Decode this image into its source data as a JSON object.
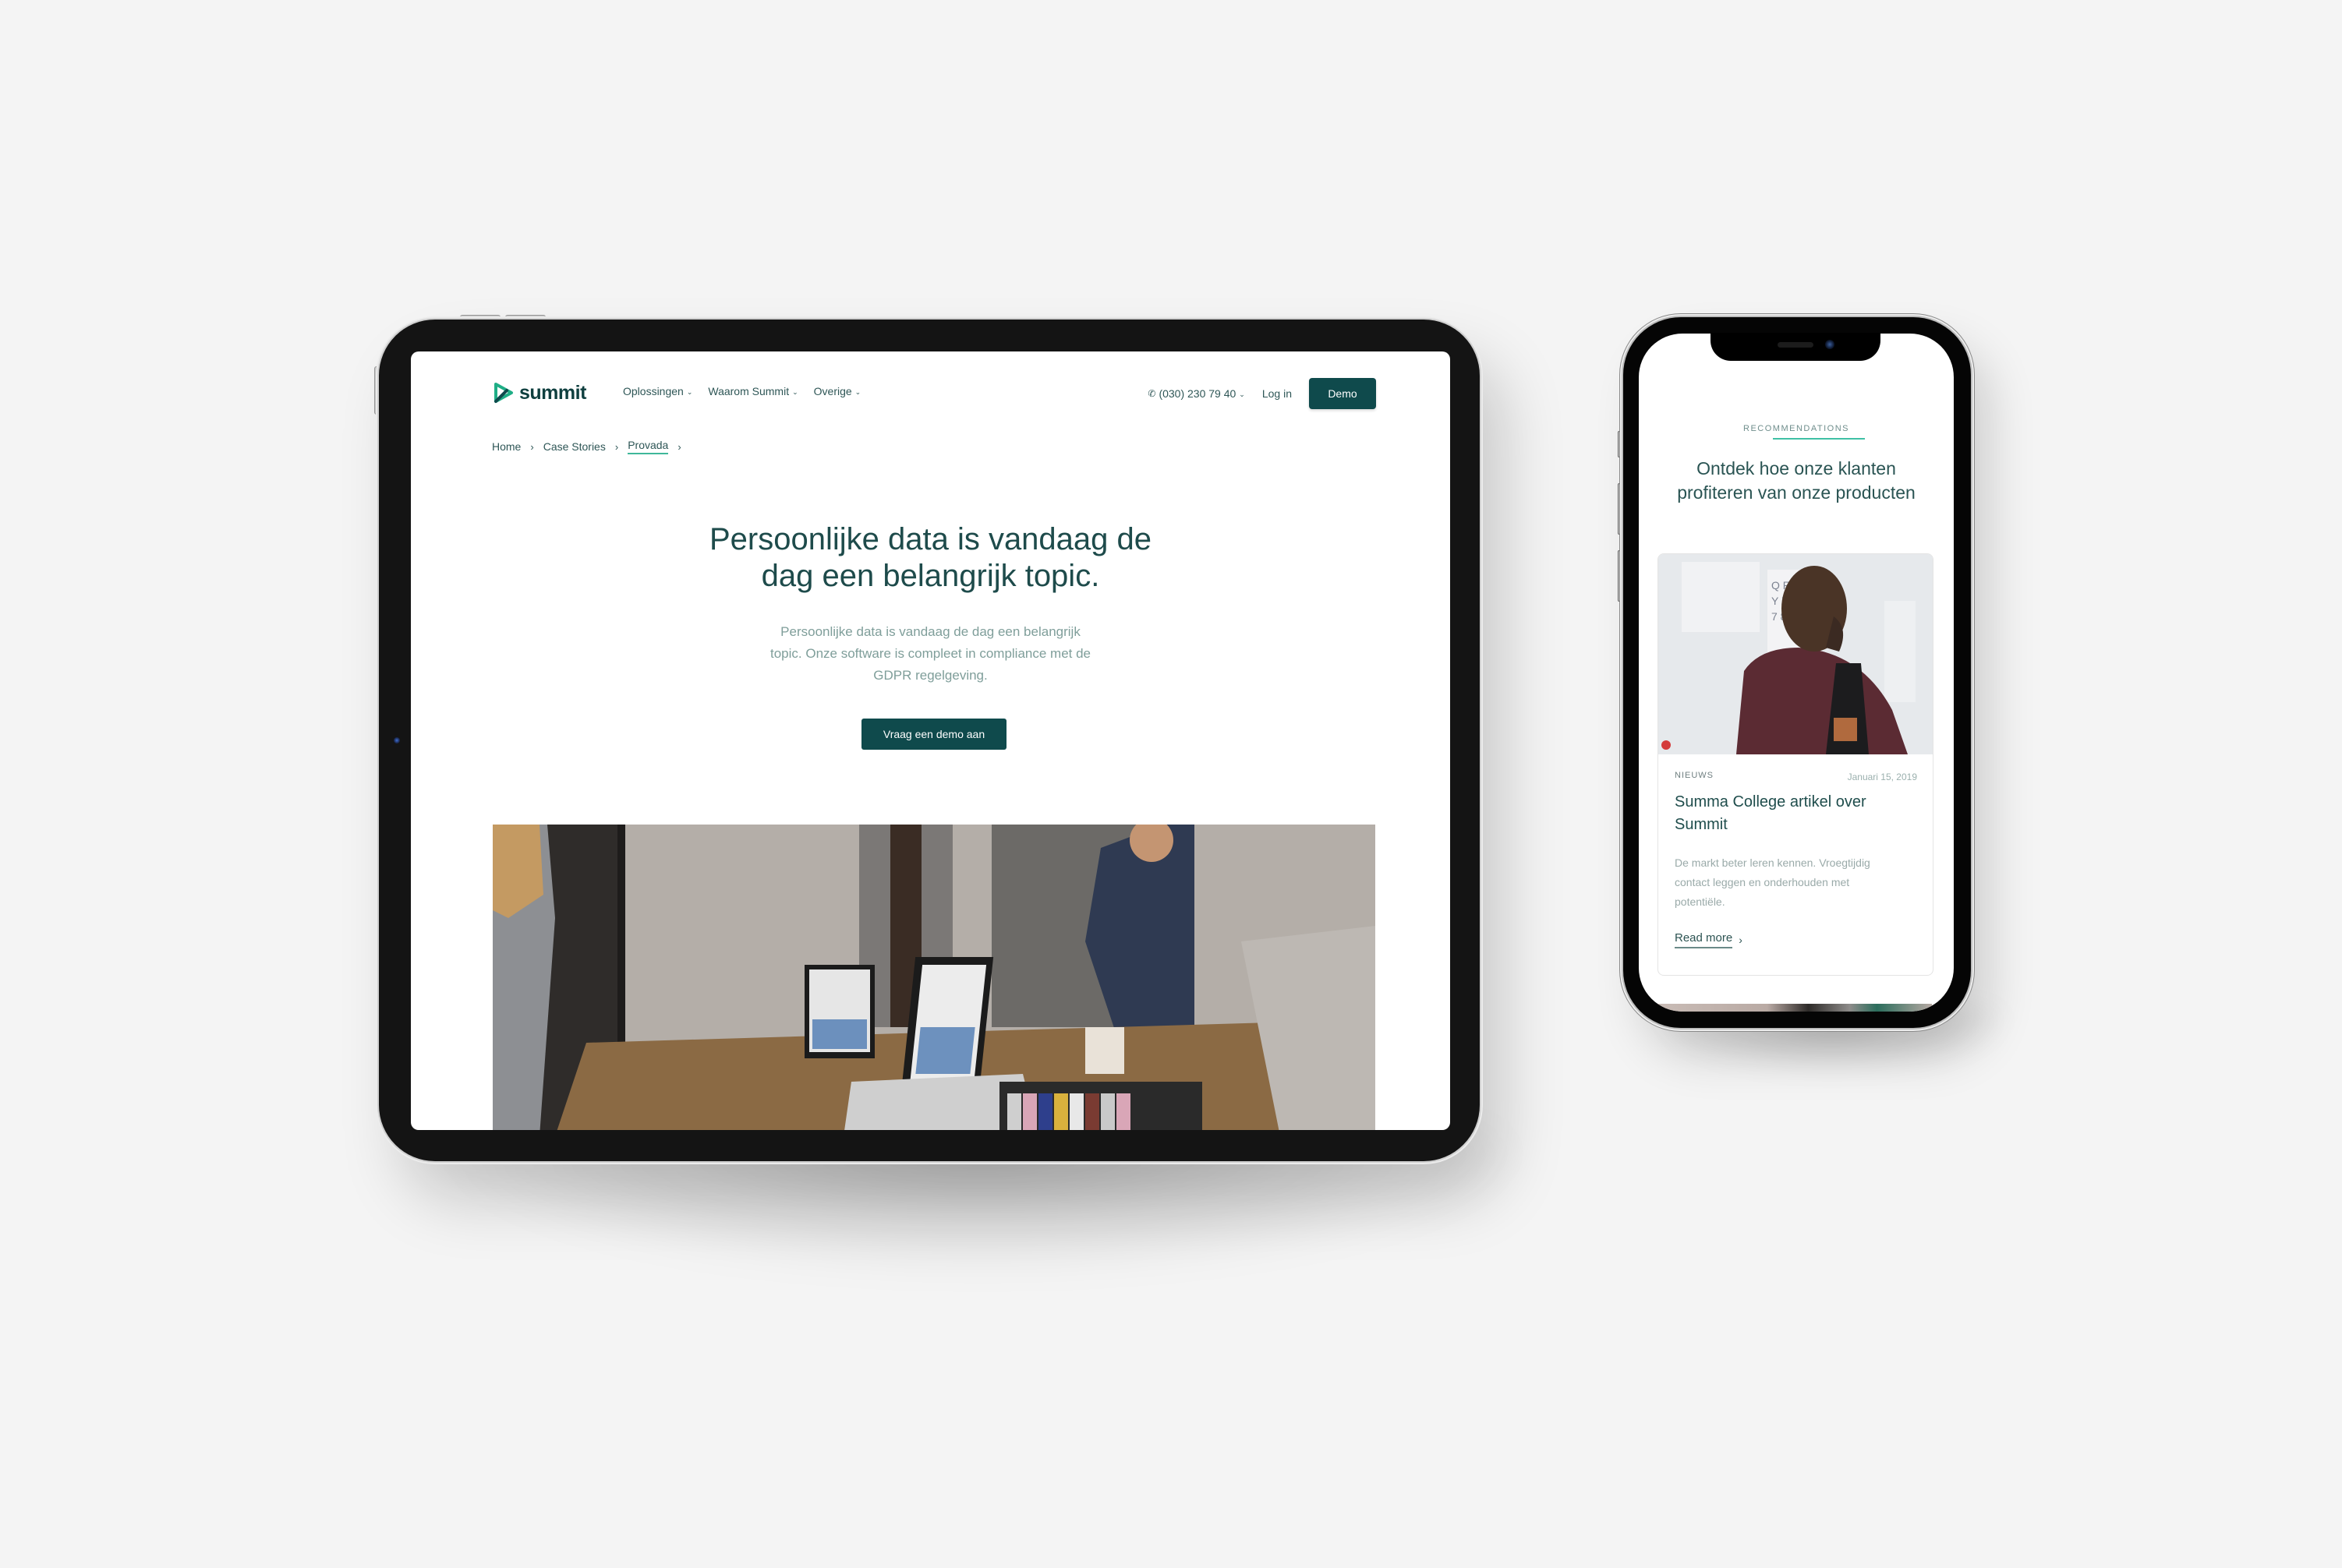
{
  "tablet": {
    "site": {
      "logo": {
        "text": "summit",
        "icon": "summit-logo-icon",
        "brand_color": "#1fae86",
        "text_color": "#0f3f3f"
      },
      "nav": {
        "items": [
          {
            "label": "Oplossingen",
            "icon": "chevron-down-icon",
            "chevron": "⌄"
          },
          {
            "label": "Waarom Summit",
            "icon": "chevron-down-icon",
            "chevron": "⌄"
          },
          {
            "label": "Overige",
            "icon": "chevron-down-icon",
            "chevron": "⌄"
          }
        ],
        "phone": {
          "icon": "phone-icon",
          "glyph": "✆",
          "label": "(030) 230 79 40",
          "chevron": "⌄"
        },
        "login_label": "Log in",
        "demo_label": "Demo"
      },
      "breadcrumb": {
        "items": [
          "Home",
          "Case Stories",
          "Provada"
        ],
        "separator": "›"
      },
      "hero": {
        "title_lines": [
          "Persoonlijke data is vandaag de",
          "dag een belangrijk topic."
        ],
        "subtitle_lines": [
          "Persoonlijke data is vandaag de dag een belangrijk",
          "topic. Onze software is compleet in compliance met de",
          "GDPR regelgeving."
        ],
        "cta_label": "Vraag een demo aan",
        "image": "team-meeting-laptops-photo"
      },
      "colors": {
        "primary": "#0f4a4c",
        "heading": "#1e4b4b",
        "muted": "#7f9e9a",
        "accent": "#3fb79a"
      }
    }
  },
  "phone": {
    "site": {
      "section_label": "RECOMMENDATIONS",
      "section_title_lines": [
        "Ontdek hoe onze klanten",
        "profiteren van onze producten"
      ],
      "card": {
        "image": "man-with-backpack-photo",
        "category": "NIEUWS",
        "date": "Januari 15, 2019",
        "title_lines": [
          "Summa College artikel over",
          "Summit"
        ],
        "description_lines": [
          "De markt beter leren kennen. Vroegtijdig",
          "contact leggen en onderhouden met",
          "potentiële."
        ],
        "link_label": "Read more",
        "link_chevron": "›"
      },
      "colors": {
        "accent": "#3fc0a5",
        "heading": "#2a5453",
        "muted": "#9aaaa9"
      }
    }
  }
}
